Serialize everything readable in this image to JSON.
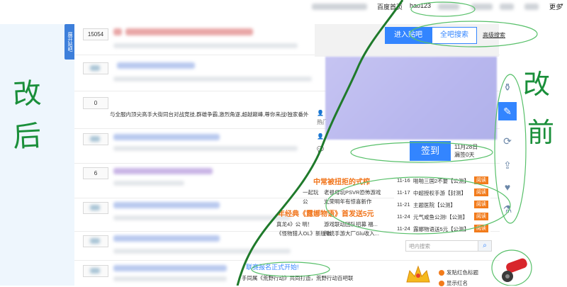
{
  "topbar": {
    "links": [
      "百度首页",
      "hao123",
      "更多"
    ]
  },
  "side_tab": {
    "label": "展开贴吧"
  },
  "annotations": {
    "left_top": "改",
    "left_bottom": "后",
    "right_top": "改",
    "right_bottom": "前"
  },
  "threads": [
    {
      "reply_count": "15054",
      "blurred_count": true
    },
    {
      "reply_count": "",
      "blurred_count": true
    },
    {
      "reply_count": "0",
      "blurred_count": false,
      "abstract": "与全服内顶尖高手大街同台对战竞技,群雄争霸,激烈角逐,超越巅峰,尊你来战!独家番外"
    },
    {
      "reply_count": "",
      "blurred_count": true
    },
    {
      "reply_count": "6",
      "blurred_count": true
    },
    {
      "reply_count": "",
      "blurred_count": true
    },
    {
      "reply_count": "",
      "blurred_count": true
    },
    {
      "reply_count": "",
      "blurred_count": true
    }
  ],
  "search_actions": {
    "enter_label": "进入贴吧",
    "search_label": "全吧搜索",
    "advanced_label": "高级搜索"
  },
  "sign": {
    "button_label": "签到",
    "date": "11月28日",
    "streak": "漏签0天"
  },
  "meta": {
    "hot_label": "热门"
  },
  "news": {
    "headline1": "中常被扭拒的式榨",
    "items1": [
      "一起玩",
      "老祖母玩PSVR恐怖游戏",
      "公",
      "光荣明年有惊喜新作"
    ],
    "headline2": "年经典《露娜物语》首发送5元",
    "items2": [
      "真龙4》公 明！",
      "游戏联动团队招募 福...",
      "《怪物猎人OL》新版本",
      "传统手游大厂Glu收入..."
    ]
  },
  "rank": [
    {
      "date": "11-16",
      "title": "啪啪三国2不要【公测】",
      "tag": "阅读"
    },
    {
      "date": "11-17",
      "title": "中超授权手游【封测】",
      "tag": "阅读"
    },
    {
      "date": "11-21",
      "title": "主题医院【公测】",
      "tag": "阅读"
    },
    {
      "date": "11-24",
      "title": "元气咸鱼公测!【公测】",
      "tag": "阅读"
    },
    {
      "date": "11-24",
      "title": "露娜物语送5元【公测】",
      "tag": "阅读"
    }
  ],
  "bar_search": {
    "placeholder": "吧内搜索"
  },
  "bottom_news": {
    "line1": "联赛报名正式开始!",
    "line2": "手同属《荒野行动》共同打造，荒野行动百吧联"
  },
  "promo": [
    "发贴红色标题",
    "显示红名"
  ],
  "toolbar_icons": [
    "bottle-icon",
    "edit-icon",
    "refresh-icon",
    "share-icon",
    "heart-icon",
    "flask-icon"
  ],
  "colors": {
    "accent": "#3385ff",
    "orange": "#f27b1b",
    "annotation": "#1a8f3a",
    "left_bg": "#eef6fd"
  }
}
